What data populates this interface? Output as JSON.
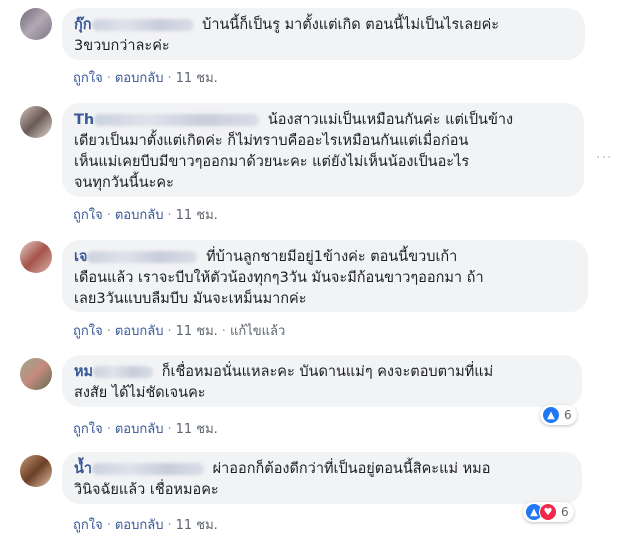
{
  "comments": [
    {
      "name": "กุ๊ก",
      "text_lines": [
        "บ้านนี้ก็เป็นรู มาตั้งแต่เกิด ตอนนี้ไม่เป็นไรเลยค่ะ",
        "3ขวบกว่าละค่ะ"
      ],
      "actions": {
        "like": "ถูกใจ",
        "reply": "ตอบกลับ",
        "time": "11 ชม."
      },
      "avatar_color": "#8a8190"
    },
    {
      "name": "Th",
      "text_lines": [
        "น้องสาวแม่เป็นเหมือนกันค่ะ แต่เป็นข้าง",
        "เดียวเป็นมาตั้งแต่เกิดค่ะ ก็ไม่ทราบคืออะไรเหมือนกันแต่เมื่อก่อน",
        "เห็นแม่เคยบีบมีขาวๆออกมาด้วยนะคะ แต่ยังไม่เห็นน้องเป็นอะไร",
        "จนทุกวันนี้นะคะ"
      ],
      "actions": {
        "like": "ถูกใจ",
        "reply": "ตอบกลับ",
        "time": "11 ชม."
      },
      "avatar_color": "#9c8b86"
    },
    {
      "name": "เจ",
      "text_lines": [
        "ที่บ้านลูกชายมีอยู่1ข้างค่ะ ตอนนี้ขวบเก้า",
        "เดือนแล้ว เราจะบีบให้ตัวน้องทุกๆ3วัน มันจะมีก้อนขาวๆออกมา ถ้า",
        "เลย3วันแบบลืมบีบ มันจะเหม็นมากค่ะ"
      ],
      "actions": {
        "like": "ถูกใจ",
        "reply": "ตอบกลับ",
        "time": "11 ชม.",
        "edited": "แก้ไขแล้ว"
      },
      "avatar_color": "#a86b63"
    },
    {
      "name": "หม",
      "text_lines": [
        "ก็เชื่อหมอนั่นแหละคะ บันดานแม่ๆ คงจะตอบตามที่แม่",
        "สงสัย ได้ไม่ชัดเจนคะ"
      ],
      "actions": {
        "like": "ถูกใจ",
        "reply": "ตอบกลับ",
        "time": "11 ชม."
      },
      "reactions": {
        "count": "6",
        "types": [
          "like"
        ]
      },
      "avatar_color": "#7d8a6e"
    },
    {
      "name": "น้ำ",
      "text_lines": [
        "ผ่าออกก็ต้องดีกว่าที่เป็นอยู่ตอนนี้สิคะแม่ หมอ",
        "วินิจฉัยแล้ว เชื่อหมอคะ"
      ],
      "actions": {
        "like": "ถูกใจ",
        "reply": "ตอบกลับ",
        "time": "11 ชม."
      },
      "reactions": {
        "count": "6",
        "types": [
          "like",
          "love"
        ]
      },
      "avatar_color": "#8a5a3e"
    }
  ],
  "more_options": "···"
}
